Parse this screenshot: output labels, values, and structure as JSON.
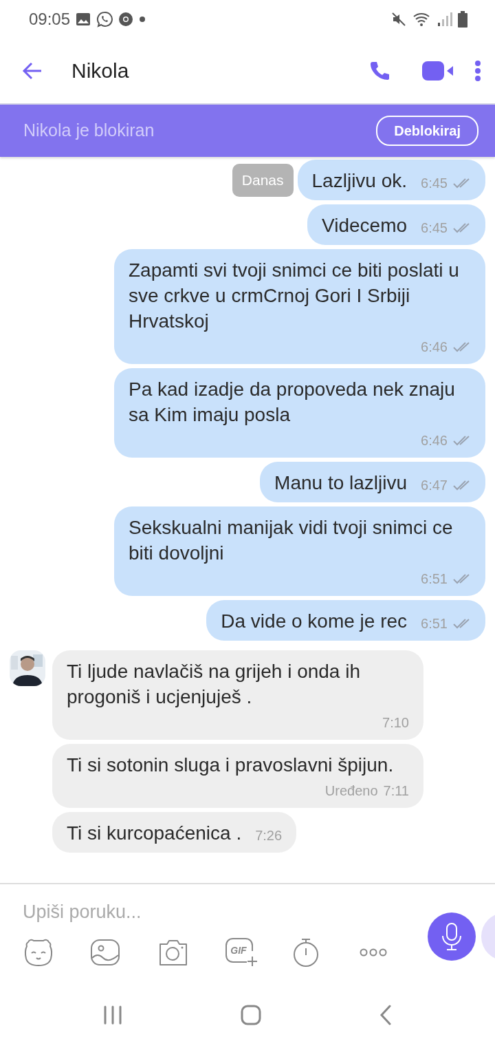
{
  "status_bar": {
    "time": "09:05"
  },
  "header": {
    "title": "Nikola"
  },
  "block_banner": {
    "text": "Nikola je blokiran",
    "button": "Deblokiraj"
  },
  "date_label": "Danas",
  "messages": [
    {
      "kind": "outgoing",
      "text": "Lazljivu ok.",
      "time": "6:45",
      "read": true
    },
    {
      "kind": "outgoing",
      "text": "Videcemo",
      "time": "6:45",
      "read": true
    },
    {
      "kind": "outgoing",
      "text": "Zapamti svi tvoji snimci ce biti poslati u sve crkve u crmCrnoj Gori I Srbiji Hrvatskoj",
      "time": "6:46",
      "read": true
    },
    {
      "kind": "outgoing",
      "text": "Pa kad izadje da propoveda nek znaju sa Kim imaju posla",
      "time": "6:46",
      "read": true
    },
    {
      "kind": "outgoing",
      "text": "Manu to lazljivu",
      "time": "6:47",
      "read": true
    },
    {
      "kind": "outgoing",
      "text": "Sekskualni manijak vidi tvoji snimci ce biti dovoljni",
      "time": "6:51",
      "read": true
    },
    {
      "kind": "outgoing",
      "text": "Da vide o kome je rec",
      "time": "6:51",
      "read": true
    },
    {
      "kind": "incoming",
      "text": "Ti ljude navlačiš na grijeh i onda ih progoniš i ucjenjuješ .",
      "time": "7:10",
      "avatar": true
    },
    {
      "kind": "incoming",
      "text": "Ti si sotonin sluga i pravoslavni špijun.",
      "time": "7:11",
      "edited": "Uređeno",
      "avatar": false
    },
    {
      "kind": "incoming",
      "text": "Ti si kurcopaćenica .",
      "time": "7:26",
      "avatar": false
    }
  ],
  "composer": {
    "placeholder": "Upiši poruku...",
    "gif_label": "GIF"
  }
}
